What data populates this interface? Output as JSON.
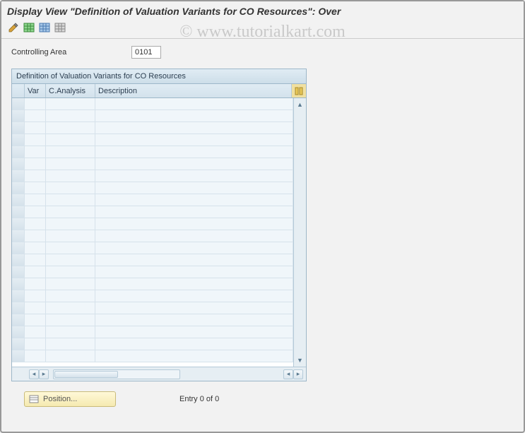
{
  "watermark": "© www.tutorialkart.com",
  "title": "Display View \"Definition of Valuation Variants for CO Resources\": Over",
  "toolbar": {
    "icons": [
      "edit-icon",
      "table-green-icon",
      "table-blue-icon",
      "table-gray-icon"
    ]
  },
  "field": {
    "label": "Controlling Area",
    "value": "0101"
  },
  "panel": {
    "title": "Definition of Valuation Variants for CO Resources",
    "columns": {
      "var": "Var",
      "canalysis": "C.Analysis",
      "description": "Description"
    },
    "config_icon": "column-config-icon",
    "rows": 22
  },
  "footer": {
    "position_icon": "position-icon",
    "position_label": "Position...",
    "entry_status": "Entry 0 of 0"
  }
}
